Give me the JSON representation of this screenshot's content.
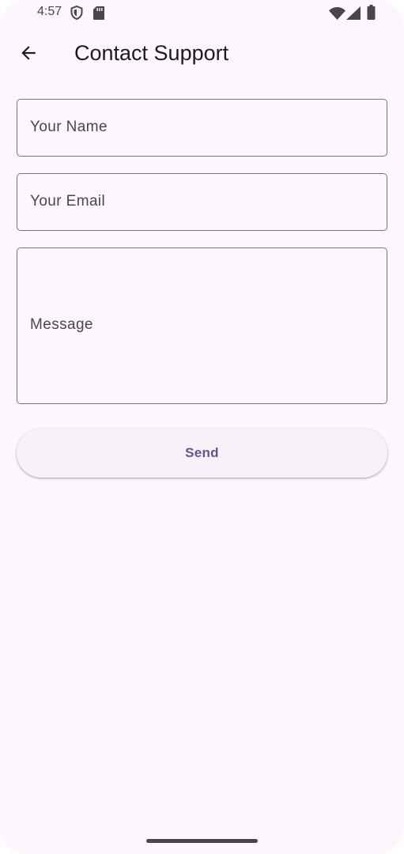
{
  "status_bar": {
    "time": "4:57",
    "icons": [
      "shield-icon",
      "sd-card-icon",
      "wifi-icon",
      "cellular-signal-icon",
      "battery-icon"
    ]
  },
  "app_bar": {
    "back_icon": "arrow-back-icon",
    "title": "Contact Support"
  },
  "form": {
    "name_label": "Your Name",
    "name_value": "",
    "email_label": "Your Email",
    "email_value": "",
    "message_label": "Message",
    "message_value": ""
  },
  "send_button": {
    "label": "Send"
  },
  "colors": {
    "background": "#fdf7fd",
    "outline": "#79747e",
    "button_surface": "#f7f1f8",
    "primary": "#65558f",
    "on_surface": "#1d1b20",
    "on_surface_variant": "#49454f"
  }
}
